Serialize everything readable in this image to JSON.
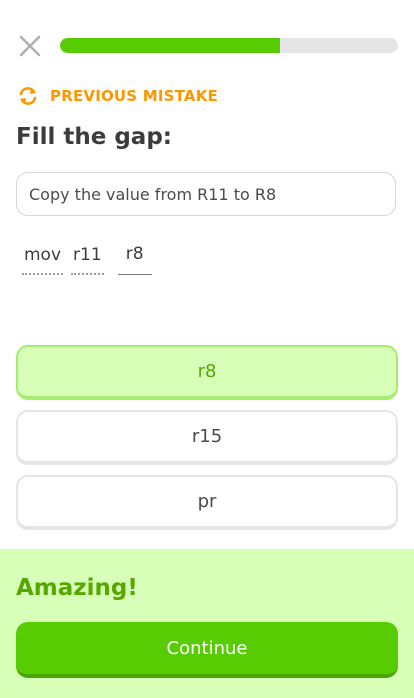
{
  "lesson": {
    "progress_fraction": 0.65
  },
  "previous_mistake": {
    "label": "PREVIOUS MISTAKE",
    "icon": "refresh-icon"
  },
  "exercise": {
    "heading": "Fill the gap:",
    "prompt": "Copy the value from R11 to R8",
    "tokens": [
      "mov",
      "r11"
    ],
    "gap_value": "r8"
  },
  "choices": [
    {
      "label": "r8",
      "selected": true
    },
    {
      "label": "r15",
      "selected": false
    },
    {
      "label": "pr",
      "selected": false
    }
  ],
  "feedback": {
    "title": "Amazing!",
    "continue_label": "Continue"
  },
  "colors": {
    "accent_green": "#58cc02",
    "orange": "#ff9600",
    "feedback_bg": "#d7ffb8"
  }
}
